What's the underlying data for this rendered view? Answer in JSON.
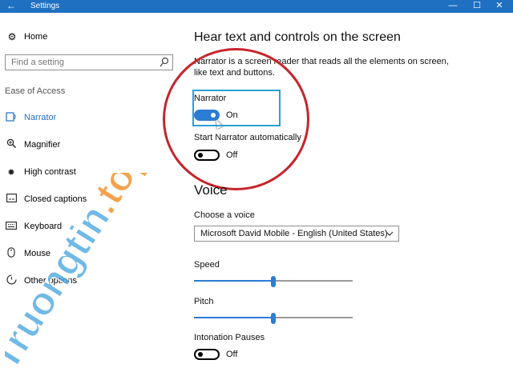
{
  "window": {
    "title": "Settings",
    "back_glyph": "←",
    "min_glyph": "—",
    "max_glyph": "☐",
    "close_glyph": "✕"
  },
  "sidebar": {
    "home_label": "Home",
    "search_placeholder": "Find a setting",
    "section_label": "Ease of Access",
    "items": [
      {
        "label": "Narrator",
        "icon": "narrator-icon",
        "active": true
      },
      {
        "label": "Magnifier",
        "icon": "magnifier-icon"
      },
      {
        "label": "High contrast",
        "icon": "high-contrast-icon"
      },
      {
        "label": "Closed captions",
        "icon": "closed-captions-icon"
      },
      {
        "label": "Keyboard",
        "icon": "keyboard-icon"
      },
      {
        "label": "Mouse",
        "icon": "mouse-icon"
      },
      {
        "label": "Other options",
        "icon": "other-options-icon"
      }
    ]
  },
  "main": {
    "heading": "Hear text and controls on the screen",
    "description": "Narrator is a screen reader that reads all the elements on screen, like text and buttons.",
    "narrator": {
      "label": "Narrator",
      "state": "On"
    },
    "auto_start": {
      "label": "Start Narrator automatically",
      "state": "Off"
    },
    "voice_heading": "Voice",
    "choose_voice": {
      "label": "Choose a voice",
      "value": "Microsoft David Mobile - English (United States)"
    },
    "speed": {
      "label": "Speed",
      "value": 0.5
    },
    "pitch": {
      "label": "Pitch",
      "value": 0.5
    },
    "intonation": {
      "label": "Intonation Pauses",
      "state": "Off"
    }
  },
  "watermark": {
    "text": "Truongtin.top"
  },
  "colors": {
    "accent": "#2b7cd3",
    "titlebar": "#1f70c1",
    "highlight_box": "#2aa0d8",
    "annotation_ring": "#c6252c",
    "watermark_blue": "#4aa6df",
    "watermark_orange": "#f08a1c"
  }
}
